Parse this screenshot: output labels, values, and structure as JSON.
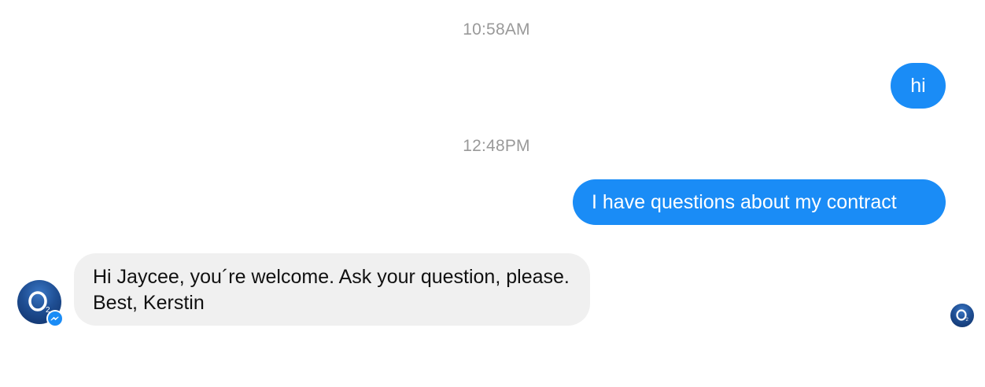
{
  "messages": [
    {
      "timestamp": "10:58AM",
      "direction": "outgoing",
      "text": "hi"
    },
    {
      "timestamp": "12:48PM",
      "direction": "outgoing",
      "text": "I have questions about my contract"
    },
    {
      "direction": "incoming",
      "text": "Hi Jaycee, you´re welcome. Ask your question, please. Best, Kerstin"
    }
  ],
  "avatar": {
    "letter": "O",
    "subscript": "2"
  },
  "colors": {
    "outgoing_bubble": "#1a8cf6",
    "incoming_bubble": "#f0f0f0",
    "timestamp": "#999999"
  },
  "icons": {
    "sender_avatar": "o2-logo-icon",
    "messenger_badge": "messenger-icon",
    "read_receipt": "o2-logo-icon"
  }
}
